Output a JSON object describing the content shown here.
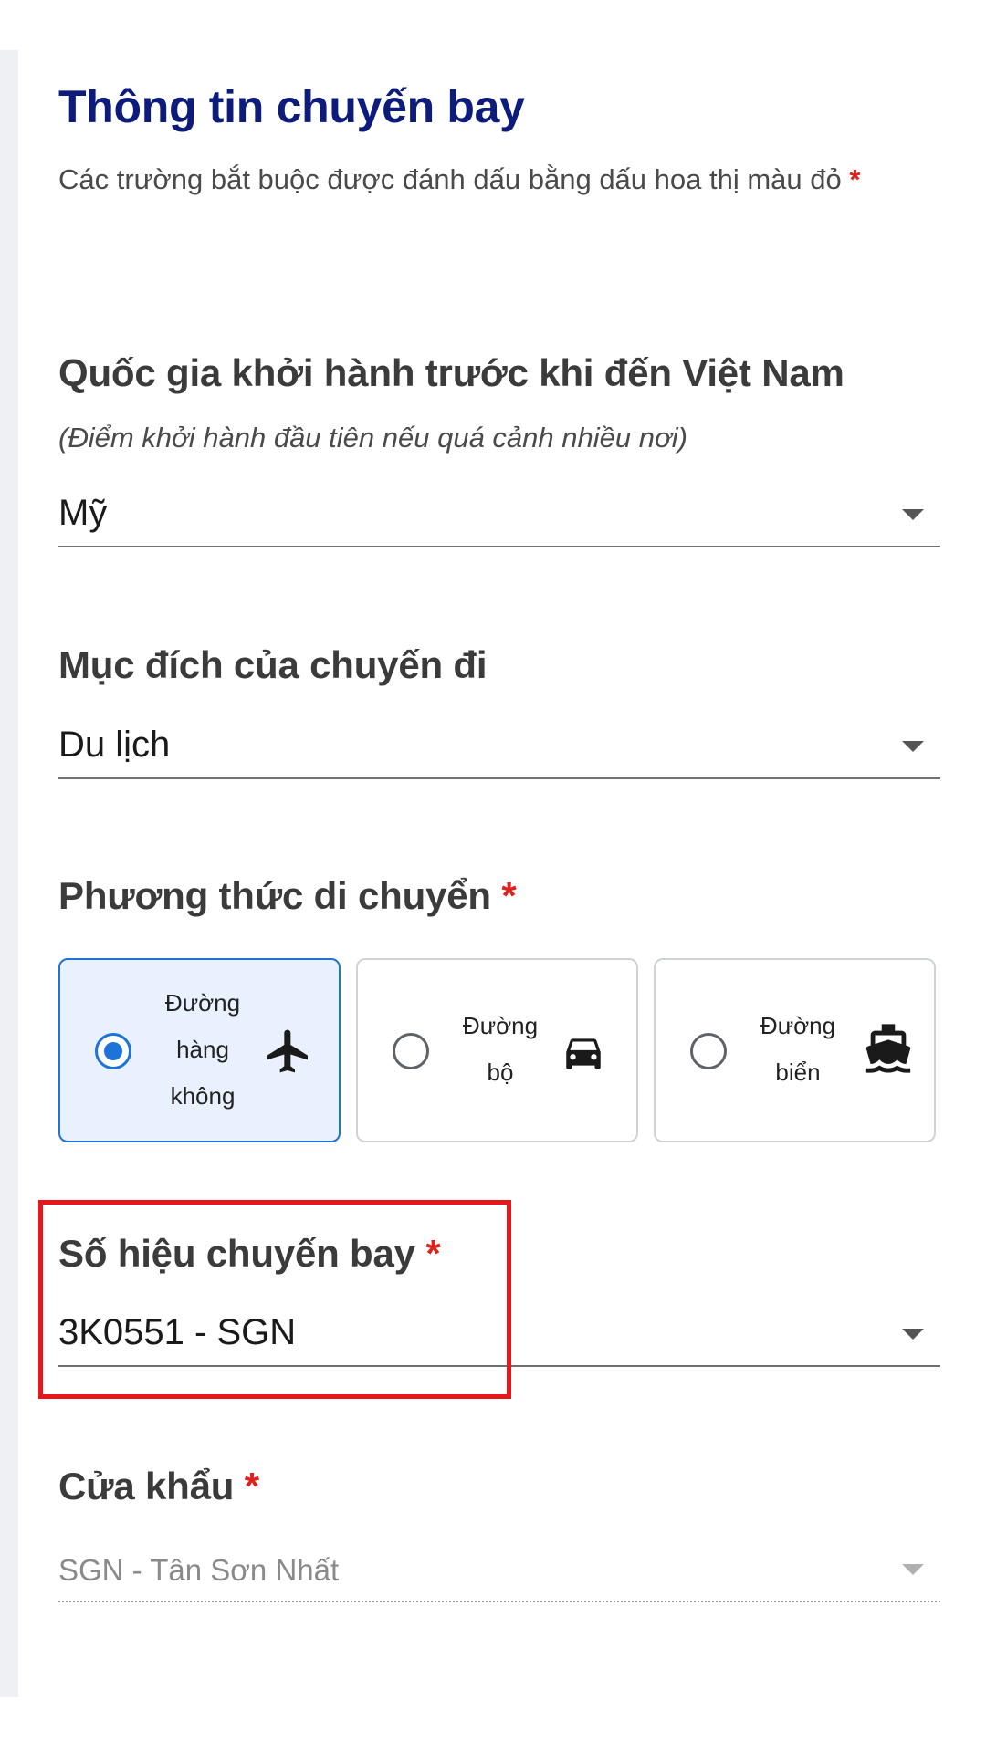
{
  "form": {
    "title": "Thông tin chuyến bay",
    "required_note": "Các trường bắt buộc được đánh dấu bằng dấu hoa thị màu đỏ",
    "required_marker": "*"
  },
  "departure_country": {
    "label": "Quốc gia khởi hành trước khi đến Việt Nam",
    "hint": "(Điểm khởi hành đầu tiên nếu quá cảnh nhiều nơi)",
    "value": "Mỹ"
  },
  "trip_purpose": {
    "label": "Mục đích của chuyến đi",
    "value": "Du lịch"
  },
  "travel_mode": {
    "label": "Phương thức di chuyển",
    "required": "*",
    "selected": "air",
    "options": [
      {
        "id": "air",
        "label": "Đường\nhàng\nkhông",
        "icon": "airplane-icon"
      },
      {
        "id": "road",
        "label": "Đường\nbộ",
        "icon": "car-icon"
      },
      {
        "id": "sea",
        "label": "Đường\nbiển",
        "icon": "ship-icon"
      }
    ]
  },
  "flight_number": {
    "label": "Số hiệu chuyến bay",
    "required": "*",
    "value": "3K0551 - SGN"
  },
  "border_gate": {
    "label": "Cửa khẩu",
    "required": "*",
    "value": "SGN -  Tân Sơn Nhất"
  },
  "colors": {
    "title": "#0d1b7a",
    "required_star": "#e0201b",
    "selected_accent": "#1e73d8",
    "highlight": "#e8151b"
  }
}
